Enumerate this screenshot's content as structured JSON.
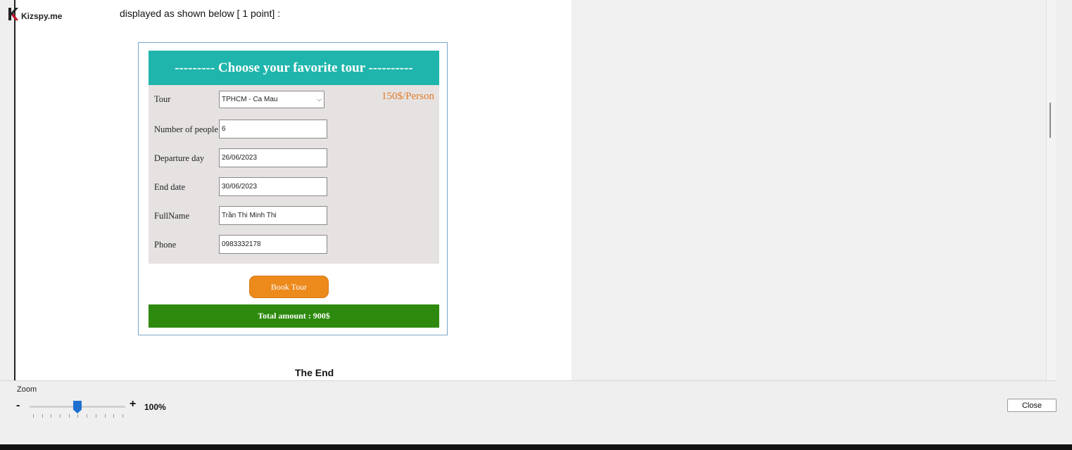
{
  "brand": {
    "logo_text": "Kizspy.me",
    "accent": "#c8102e"
  },
  "document": {
    "intro_text": "displayed as shown below [ 1 point] :",
    "end_text": "The End"
  },
  "form": {
    "title": "--------- Choose your favorite tour ----------",
    "price_text": "150$/Person",
    "fields": [
      {
        "label": "Tour",
        "value": "TPHCM - Ca Mau",
        "kind": "select"
      },
      {
        "label": "Number of people",
        "value": "6",
        "kind": "input"
      },
      {
        "label": "Departure day",
        "value": "26/06/2023",
        "kind": "input"
      },
      {
        "label": "End date",
        "value": "30/06/2023",
        "kind": "input"
      },
      {
        "label": "FullName",
        "value": "Trần Thi Minh Thi",
        "kind": "input"
      },
      {
        "label": "Phone",
        "value": "0983332178",
        "kind": "input"
      }
    ],
    "book_button": "Book Tour",
    "total_text": "Total amount : 900$",
    "colors": {
      "header": "#1fb5ac",
      "body": "#e6e2e2",
      "price": "#e07a26",
      "button": "#ec8a1c",
      "total": "#2d8a0e"
    }
  },
  "viewer": {
    "zoom_label": "Zoom",
    "zoom_minus": "-",
    "zoom_plus": "+",
    "zoom_value": "100%",
    "zoom_level": 0.5,
    "close_button": "Close"
  }
}
